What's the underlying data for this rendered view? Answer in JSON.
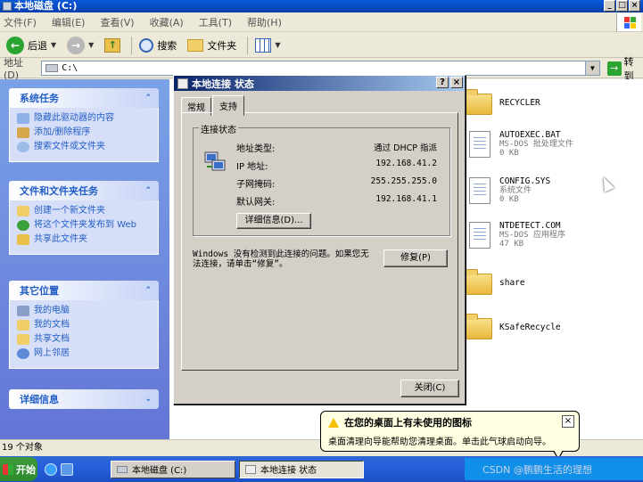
{
  "window": {
    "title": "本地磁盘 (C:)"
  },
  "menu": [
    "文件(F)",
    "编辑(E)",
    "查看(V)",
    "收藏(A)",
    "工具(T)",
    "帮助(H)"
  ],
  "toolbar": {
    "back": "后退",
    "search": "搜索",
    "folders": "文件夹"
  },
  "address": {
    "label": "地址(D)",
    "value": "C:\\",
    "go": "转到"
  },
  "taskpane": {
    "system_tasks": {
      "title": "系统任务",
      "items": [
        "隐藏此驱动器的内容",
        "添加/删除程序",
        "搜索文件或文件夹"
      ]
    },
    "file_tasks": {
      "title": "文件和文件夹任务",
      "items": [
        "创建一个新文件夹",
        "将这个文件夹发布到 Web",
        "共享此文件夹"
      ]
    },
    "other_places": {
      "title": "其它位置",
      "items": [
        "我的电脑",
        "我的文档",
        "共享文档",
        "网上邻居"
      ]
    },
    "details": {
      "title": "详细信息"
    }
  },
  "files": [
    {
      "name": "RECYCLER",
      "type": "folder",
      "desc": "",
      "size": ""
    },
    {
      "name": "AUTOEXEC.BAT",
      "type": "doc",
      "desc": "MS-DOS 批处理文件",
      "size": "0 KB"
    },
    {
      "name": "CONFIG.SYS",
      "type": "doc",
      "desc": "系统文件",
      "size": "0 KB"
    },
    {
      "name": "NTDETECT.COM",
      "type": "doc",
      "desc": "MS-DOS 应用程序",
      "size": "47 KB"
    },
    {
      "name": "share",
      "type": "folder",
      "desc": "",
      "size": ""
    },
    {
      "name": "KSafeRecycle",
      "type": "folder",
      "desc": "",
      "size": ""
    }
  ],
  "status": {
    "count": "19 个对象"
  },
  "dialog": {
    "title": "本地连接 状态",
    "tabs": [
      "常规",
      "支持"
    ],
    "group": "连接状态",
    "rows": [
      {
        "label": "地址类型:",
        "value": "通过 DHCP 指派"
      },
      {
        "label": "IP 地址:",
        "value": "192.168.41.2"
      },
      {
        "label": "子网掩码:",
        "value": "255.255.255.0"
      },
      {
        "label": "默认网关:",
        "value": "192.168.41.1"
      }
    ],
    "details_btn": "详细信息(D)...",
    "message": "Windows 没有检测到此连接的问题。如果您无法连接，请单击“修复”。",
    "repair_btn": "修复(P)",
    "close_btn": "关闭(C)"
  },
  "balloon": {
    "title": "在您的桌面上有未使用的图标",
    "body": "桌面清理向导能帮助您清理桌面。单击此气球启动向导。"
  },
  "taskbar": {
    "start": "开始",
    "tasks": [
      "本地磁盘 (C:)",
      "本地连接 状态"
    ],
    "tray": "CSDN @鹏鹏生活的理想"
  }
}
